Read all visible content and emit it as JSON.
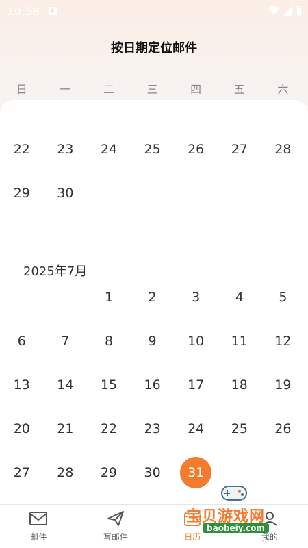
{
  "status_bar": {
    "time": "10:58"
  },
  "header": {
    "title": "按日期定位邮件"
  },
  "weekdays": [
    "日",
    "一",
    "二",
    "三",
    "四",
    "五",
    "六"
  ],
  "calendar": {
    "prev_month_rows": [
      [
        "22",
        "23",
        "24",
        "25",
        "26",
        "27",
        "28"
      ],
      [
        "29",
        "30",
        "",
        "",
        "",
        "",
        ""
      ]
    ],
    "month_title": "2025年7月",
    "month_rows": [
      [
        "",
        "",
        "1",
        "2",
        "3",
        "4",
        "5"
      ],
      [
        "6",
        "7",
        "8",
        "9",
        "10",
        "11",
        "12"
      ],
      [
        "13",
        "14",
        "15",
        "16",
        "17",
        "18",
        "19"
      ],
      [
        "20",
        "21",
        "22",
        "23",
        "24",
        "25",
        "26"
      ],
      [
        "27",
        "28",
        "29",
        "30",
        "31",
        "",
        ""
      ]
    ],
    "selected_day": "31"
  },
  "tabbar": {
    "tabs": [
      {
        "label": "邮件",
        "icon": "mail-icon"
      },
      {
        "label": "写邮件",
        "icon": "send-icon"
      },
      {
        "label": "日历",
        "icon": "calendar-icon"
      },
      {
        "label": "我的",
        "icon": "profile-icon"
      }
    ],
    "active_index": 2
  },
  "watermark": {
    "text": "宝贝游戏网",
    "url": "baobeiy.com"
  },
  "colors": {
    "accent": "#f47b2e",
    "text": "#333333",
    "weekday": "#888888"
  }
}
